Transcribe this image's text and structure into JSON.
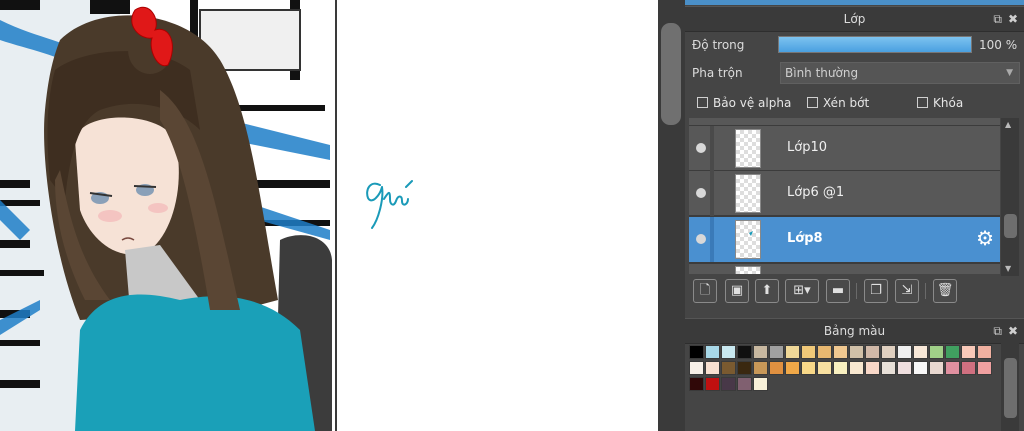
{
  "layer_panel": {
    "title": "Lớp",
    "float_icon": "float-window-icon",
    "close_icon": "close-icon",
    "opacity_label": "Độ trong",
    "opacity_value": "100 %",
    "opacity_fraction": 1.0,
    "blend_label": "Pha trộn",
    "blend_value": "Bình thường",
    "protect_alpha_label": "Bảo vệ alpha",
    "clipping_label": "Xén bớt",
    "lock_label": "Khóa",
    "layers": [
      {
        "name": "Lớp10",
        "selected": false
      },
      {
        "name": "Lớp6 @1",
        "selected": false
      },
      {
        "name": "Lớp8",
        "selected": true
      }
    ]
  },
  "palette_panel": {
    "title": "Bảng màu",
    "rows": [
      [
        "#000000",
        "#a8d8e8",
        "#c8e8f0",
        "#101010",
        "#c8b8a0",
        "#a0a0a0",
        "#f0d898",
        "#f0c878",
        "#e8b870",
        "#f0c890",
        "#d0c0a8",
        "#d0b8a8",
        "#e0d0c0",
        "#f0f0f0",
        "#f8e8d8",
        "#a0d088",
        "#40a060",
        "#f8c8b8",
        "#f0b0a0"
      ],
      [
        "#f8f0e8",
        "#f8e0d0",
        "#7a5a30",
        "#3a2810",
        "#c89858",
        "#e09040",
        "#f0a848",
        "#f8d888",
        "#f8e0a0",
        "#f8f0c0",
        "#f8e8d0",
        "#f8d8c8",
        "#e8e0d8",
        "#f0e0e0",
        "#f8f8f8",
        "#e8d8d0",
        "#e090a0",
        "#d07080",
        "#f0a0a0"
      ],
      [
        "#300808",
        "#c01010",
        "#483848",
        "#806070",
        "#f8f0d8"
      ]
    ]
  }
}
